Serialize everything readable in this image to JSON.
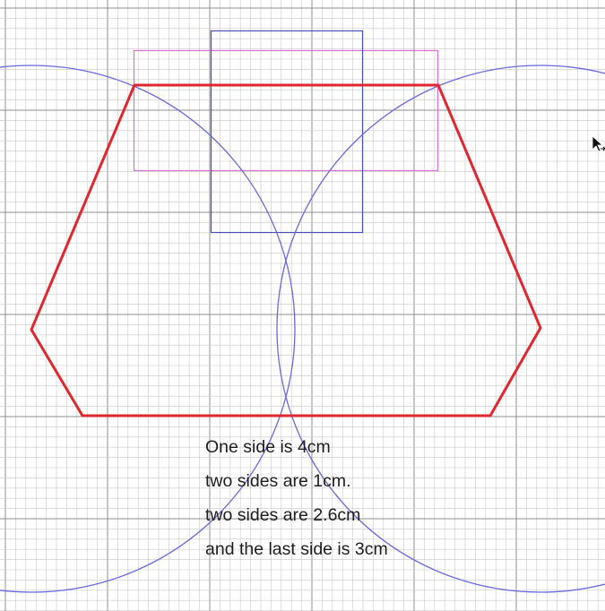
{
  "canvas": {
    "background_color": "#ffffff",
    "grid": {
      "minor_color": "#c8c8c8",
      "major_color": "#8f8f8f"
    }
  },
  "guides": {
    "magenta_rect_color": "#d86ed8",
    "blue_rect_color": "#4a52b8",
    "circle_color": "#6a6ae0"
  },
  "shape": {
    "outline_color": "#e0262e"
  },
  "note": {
    "lines": [
      "One side is 4cm",
      "two sides are 1cm.",
      "two sides are 2.6cm",
      "and the last side is 3cm"
    ]
  },
  "cursor": {
    "icon": "cursor-arrow-icon"
  }
}
